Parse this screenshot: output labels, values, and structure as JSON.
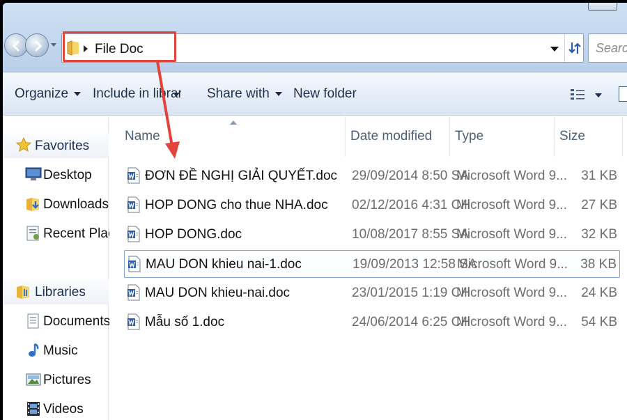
{
  "window": {
    "title": "File Doc"
  },
  "address": {
    "crumb": "File Doc"
  },
  "search": {
    "placeholder": "Search"
  },
  "toolbar": {
    "organize": "Organize",
    "include_in_library": "Include in library",
    "share_with": "Share with",
    "new_folder": "New folder"
  },
  "sidebar": {
    "favorites": "Favorites",
    "desktop": "Desktop",
    "downloads": "Downloads",
    "recent_places": "Recent Places",
    "libraries": "Libraries",
    "documents": "Documents",
    "music": "Music",
    "pictures": "Pictures",
    "videos": "Videos"
  },
  "columns": {
    "name": "Name",
    "date": "Date modified",
    "type": "Type",
    "size": "Size"
  },
  "files": [
    {
      "name": "ĐƠN ĐỀ NGHỊ GIẢI QUYẾT.doc",
      "date": "29/09/2014 8:50 SA",
      "type": "Microsoft Word 9...",
      "size": "31 KB"
    },
    {
      "name": "HOP DONG cho thue NHA.doc",
      "date": "02/12/2016 4:31 CH",
      "type": "Microsoft Word 9...",
      "size": "27 KB"
    },
    {
      "name": "HOP DONG.doc",
      "date": "10/08/2017 8:55 SA",
      "type": "Microsoft Word 9...",
      "size": "32 KB"
    },
    {
      "name": "MAU DON khieu nai-1.doc",
      "date": "19/09/2013 12:58 SA",
      "type": "Microsoft Word 9...",
      "size": "38 KB"
    },
    {
      "name": "MAU DON khieu-nai.doc",
      "date": "23/01/2015 1:19 CH",
      "type": "Microsoft Word 9...",
      "size": "24 KB"
    },
    {
      "name": "Mẫu số 1.doc",
      "date": "24/06/2014 6:25 CH",
      "type": "Microsoft Word 9...",
      "size": "54 KB"
    }
  ],
  "colors": {
    "highlight": "#e0443a",
    "accent": "#1d2f4a",
    "selection_border": "#7da2ce"
  }
}
